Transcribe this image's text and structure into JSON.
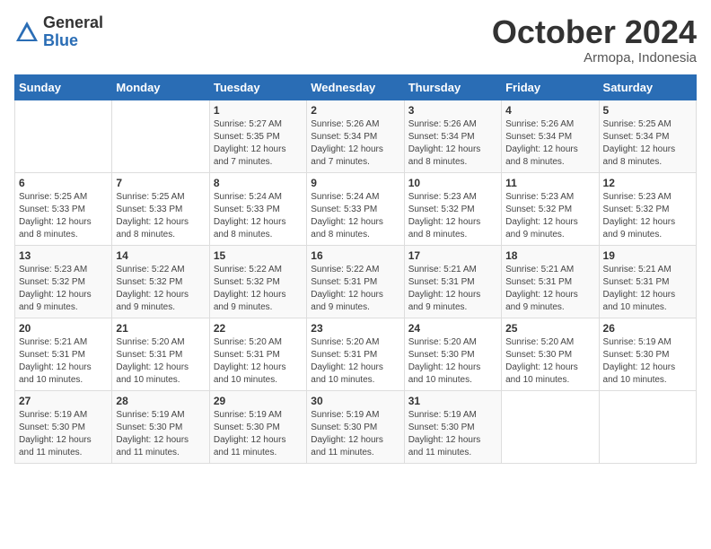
{
  "logo": {
    "general": "General",
    "blue": "Blue"
  },
  "title": "October 2024",
  "subtitle": "Armopa, Indonesia",
  "days_header": [
    "Sunday",
    "Monday",
    "Tuesday",
    "Wednesday",
    "Thursday",
    "Friday",
    "Saturday"
  ],
  "weeks": [
    [
      {
        "day": "",
        "info": ""
      },
      {
        "day": "",
        "info": ""
      },
      {
        "day": "1",
        "info": "Sunrise: 5:27 AM\nSunset: 5:35 PM\nDaylight: 12 hours and 7 minutes."
      },
      {
        "day": "2",
        "info": "Sunrise: 5:26 AM\nSunset: 5:34 PM\nDaylight: 12 hours and 7 minutes."
      },
      {
        "day": "3",
        "info": "Sunrise: 5:26 AM\nSunset: 5:34 PM\nDaylight: 12 hours and 8 minutes."
      },
      {
        "day": "4",
        "info": "Sunrise: 5:26 AM\nSunset: 5:34 PM\nDaylight: 12 hours and 8 minutes."
      },
      {
        "day": "5",
        "info": "Sunrise: 5:25 AM\nSunset: 5:34 PM\nDaylight: 12 hours and 8 minutes."
      }
    ],
    [
      {
        "day": "6",
        "info": "Sunrise: 5:25 AM\nSunset: 5:33 PM\nDaylight: 12 hours and 8 minutes."
      },
      {
        "day": "7",
        "info": "Sunrise: 5:25 AM\nSunset: 5:33 PM\nDaylight: 12 hours and 8 minutes."
      },
      {
        "day": "8",
        "info": "Sunrise: 5:24 AM\nSunset: 5:33 PM\nDaylight: 12 hours and 8 minutes."
      },
      {
        "day": "9",
        "info": "Sunrise: 5:24 AM\nSunset: 5:33 PM\nDaylight: 12 hours and 8 minutes."
      },
      {
        "day": "10",
        "info": "Sunrise: 5:23 AM\nSunset: 5:32 PM\nDaylight: 12 hours and 8 minutes."
      },
      {
        "day": "11",
        "info": "Sunrise: 5:23 AM\nSunset: 5:32 PM\nDaylight: 12 hours and 9 minutes."
      },
      {
        "day": "12",
        "info": "Sunrise: 5:23 AM\nSunset: 5:32 PM\nDaylight: 12 hours and 9 minutes."
      }
    ],
    [
      {
        "day": "13",
        "info": "Sunrise: 5:23 AM\nSunset: 5:32 PM\nDaylight: 12 hours and 9 minutes."
      },
      {
        "day": "14",
        "info": "Sunrise: 5:22 AM\nSunset: 5:32 PM\nDaylight: 12 hours and 9 minutes."
      },
      {
        "day": "15",
        "info": "Sunrise: 5:22 AM\nSunset: 5:32 PM\nDaylight: 12 hours and 9 minutes."
      },
      {
        "day": "16",
        "info": "Sunrise: 5:22 AM\nSunset: 5:31 PM\nDaylight: 12 hours and 9 minutes."
      },
      {
        "day": "17",
        "info": "Sunrise: 5:21 AM\nSunset: 5:31 PM\nDaylight: 12 hours and 9 minutes."
      },
      {
        "day": "18",
        "info": "Sunrise: 5:21 AM\nSunset: 5:31 PM\nDaylight: 12 hours and 9 minutes."
      },
      {
        "day": "19",
        "info": "Sunrise: 5:21 AM\nSunset: 5:31 PM\nDaylight: 12 hours and 10 minutes."
      }
    ],
    [
      {
        "day": "20",
        "info": "Sunrise: 5:21 AM\nSunset: 5:31 PM\nDaylight: 12 hours and 10 minutes."
      },
      {
        "day": "21",
        "info": "Sunrise: 5:20 AM\nSunset: 5:31 PM\nDaylight: 12 hours and 10 minutes."
      },
      {
        "day": "22",
        "info": "Sunrise: 5:20 AM\nSunset: 5:31 PM\nDaylight: 12 hours and 10 minutes."
      },
      {
        "day": "23",
        "info": "Sunrise: 5:20 AM\nSunset: 5:31 PM\nDaylight: 12 hours and 10 minutes."
      },
      {
        "day": "24",
        "info": "Sunrise: 5:20 AM\nSunset: 5:30 PM\nDaylight: 12 hours and 10 minutes."
      },
      {
        "day": "25",
        "info": "Sunrise: 5:20 AM\nSunset: 5:30 PM\nDaylight: 12 hours and 10 minutes."
      },
      {
        "day": "26",
        "info": "Sunrise: 5:19 AM\nSunset: 5:30 PM\nDaylight: 12 hours and 10 minutes."
      }
    ],
    [
      {
        "day": "27",
        "info": "Sunrise: 5:19 AM\nSunset: 5:30 PM\nDaylight: 12 hours and 11 minutes."
      },
      {
        "day": "28",
        "info": "Sunrise: 5:19 AM\nSunset: 5:30 PM\nDaylight: 12 hours and 11 minutes."
      },
      {
        "day": "29",
        "info": "Sunrise: 5:19 AM\nSunset: 5:30 PM\nDaylight: 12 hours and 11 minutes."
      },
      {
        "day": "30",
        "info": "Sunrise: 5:19 AM\nSunset: 5:30 PM\nDaylight: 12 hours and 11 minutes."
      },
      {
        "day": "31",
        "info": "Sunrise: 5:19 AM\nSunset: 5:30 PM\nDaylight: 12 hours and 11 minutes."
      },
      {
        "day": "",
        "info": ""
      },
      {
        "day": "",
        "info": ""
      }
    ]
  ]
}
